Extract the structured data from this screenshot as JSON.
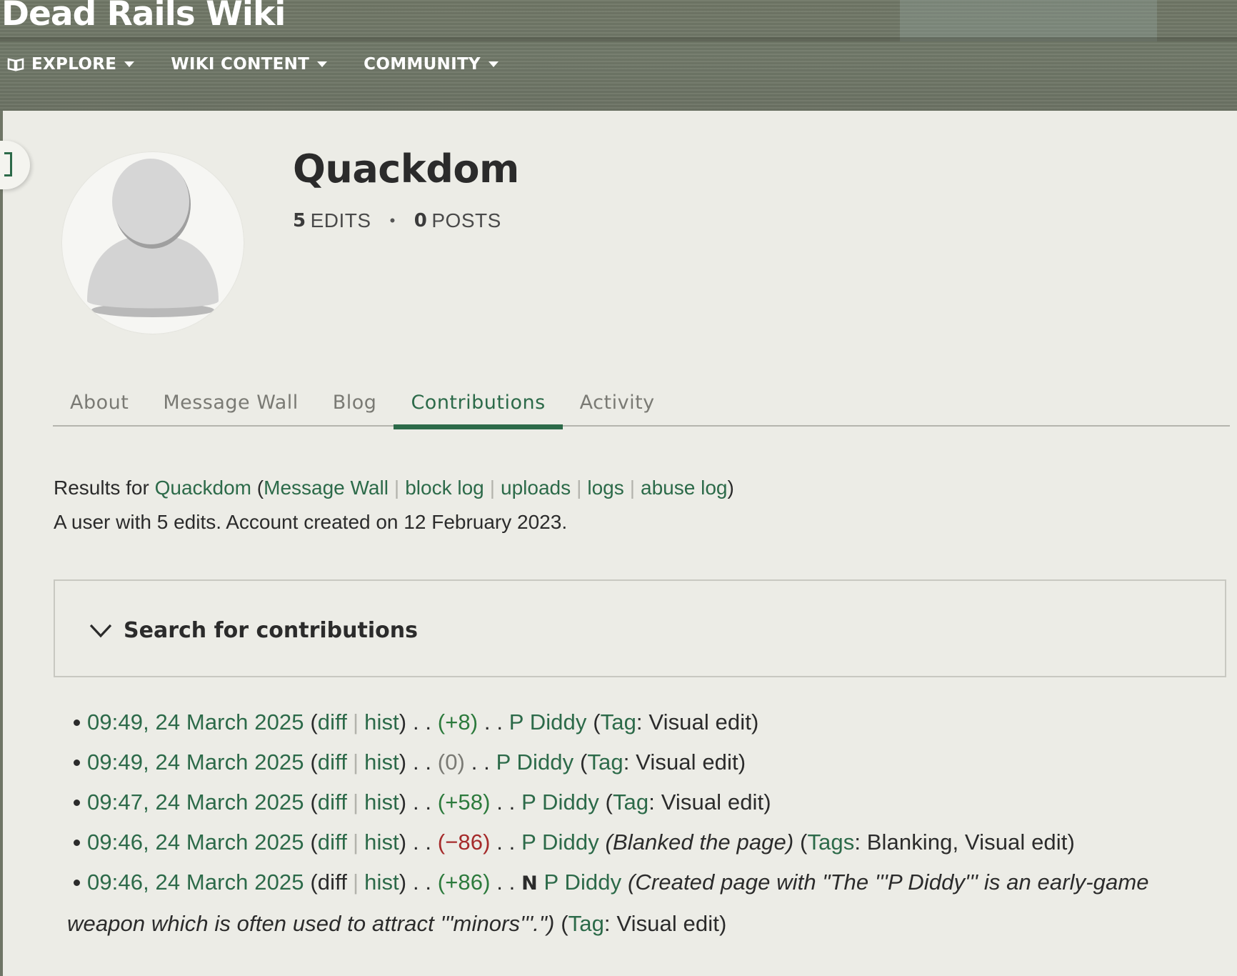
{
  "wiki": {
    "title": "Dead Rails Wiki"
  },
  "nav": [
    {
      "label": "EXPLORE",
      "icon": "book-icon"
    },
    {
      "label": "WIKI CONTENT"
    },
    {
      "label": "COMMUNITY"
    }
  ],
  "profile": {
    "username": "Quackdom",
    "edits_count": "5",
    "edits_label": "EDITS",
    "posts_count": "0",
    "posts_label": "POSTS",
    "separator": "•"
  },
  "tabs": [
    {
      "label": "About"
    },
    {
      "label": "Message Wall"
    },
    {
      "label": "Blog"
    },
    {
      "label": "Contributions",
      "active": true
    },
    {
      "label": "Activity"
    }
  ],
  "results": {
    "prefix": "Results for ",
    "user": "Quackdom",
    "open": " (",
    "links": [
      "Message Wall",
      "block log",
      "uploads",
      "logs",
      "abuse log"
    ],
    "close": ")",
    "account_line": "A user with 5 edits. Account created on 12 February 2023."
  },
  "search": {
    "title": "Search for contributions"
  },
  "contributions": [
    {
      "time": "09:49, 24 March 2025",
      "diff": "diff",
      "hist": "hist",
      "size": "(+8)",
      "page": "P Diddy",
      "tag_label": "Tag",
      "tags": "Visual edit"
    },
    {
      "time": "09:49, 24 March 2025",
      "diff": "diff",
      "hist": "hist",
      "size": "(0)",
      "page": "P Diddy",
      "tag_label": "Tag",
      "tags": "Visual edit"
    },
    {
      "time": "09:47, 24 March 2025",
      "diff": "diff",
      "hist": "hist",
      "size": "(+58)",
      "page": "P Diddy",
      "tag_label": "Tag",
      "tags": "Visual edit"
    },
    {
      "time": "09:46, 24 March 2025",
      "diff": "diff",
      "hist": "hist",
      "size": "(−86)",
      "page": "P Diddy",
      "comment": "(Blanked the page)",
      "tag_label": "Tags",
      "tags": "Blanking, Visual edit"
    },
    {
      "time": "09:46, 24 March 2025",
      "diff": "diff",
      "hist": "hist",
      "size": "(+86)",
      "new_flag": "N",
      "page": "P Diddy",
      "comment_1": "(Created page with \"The '''P Diddy''' is an early-game",
      "comment_2": "weapon which is often used to attract '''minors'''.\")",
      "tag_label": "Tag",
      "tags": "Visual edit"
    }
  ],
  "text": {
    "open_paren": "(",
    "close_paren": ")",
    "dots": ". .",
    "colon": ": ",
    "pipe": "|"
  },
  "colors": {
    "accent": "#2c6a49",
    "positive": "#2c7a3c",
    "negative": "#a52a2a",
    "page_bg": "#ecece6"
  }
}
